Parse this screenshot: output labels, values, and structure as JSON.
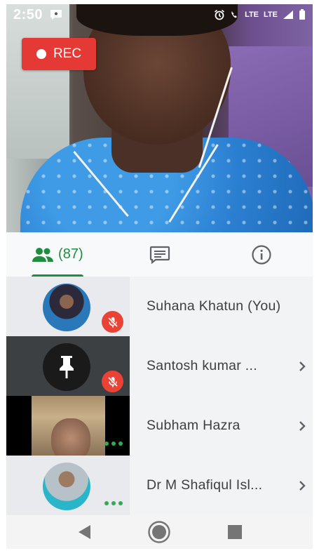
{
  "status_bar": {
    "time": "2:50",
    "network": "LTE",
    "network2": "LTE"
  },
  "recording": {
    "label": "REC"
  },
  "tabs": {
    "participants_count": "(87)"
  },
  "participants": [
    {
      "name": "Suhana Khatun (You)",
      "muted": true,
      "has_chevron": false
    },
    {
      "name": "Santosh kumar ...",
      "muted": true,
      "has_chevron": true
    },
    {
      "name": "Subham Hazra",
      "muted": false,
      "has_chevron": true
    },
    {
      "name": "Dr M Shafiqul Isl...",
      "muted": false,
      "has_chevron": true
    }
  ],
  "colors": {
    "accent": "#1e8e3e",
    "rec": "#e53935",
    "mute": "#ea4335",
    "speaking_dots": "#34a853"
  }
}
